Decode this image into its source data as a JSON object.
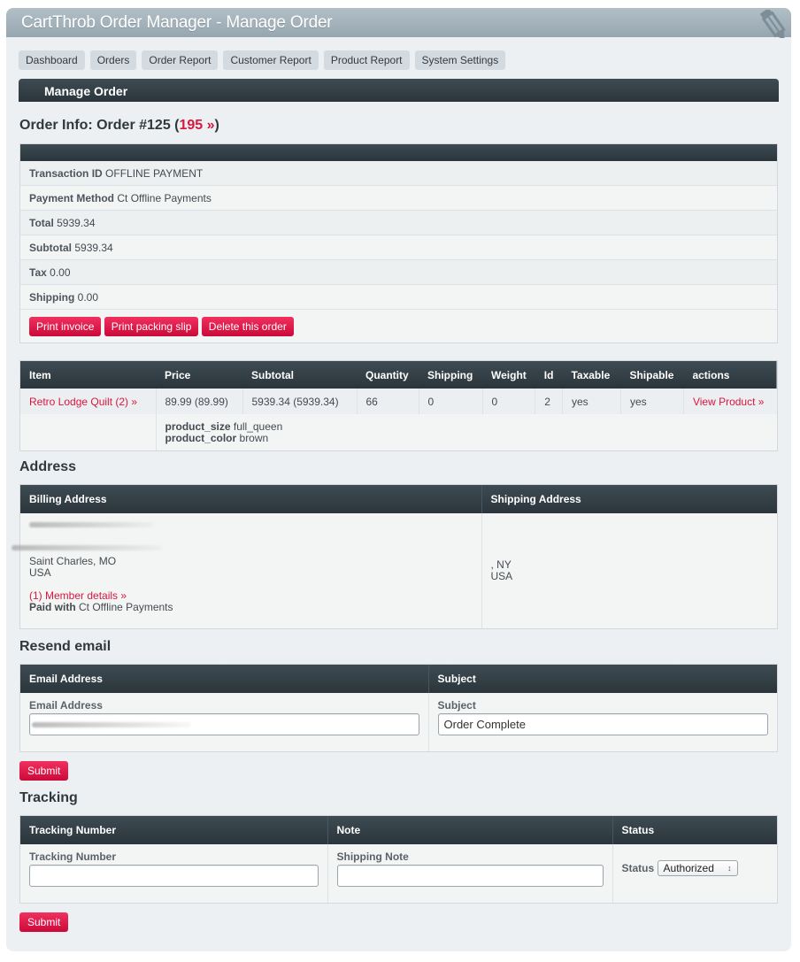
{
  "window": {
    "title": "CartThrob Order Manager - Manage Order",
    "corner_icon": "pencil-icon"
  },
  "nav": {
    "items": [
      {
        "label": "Dashboard"
      },
      {
        "label": "Orders"
      },
      {
        "label": "Order Report"
      },
      {
        "label": "Customer Report"
      },
      {
        "label": "Product Report"
      },
      {
        "label": "System Settings"
      }
    ]
  },
  "section_bar": {
    "title": "Manage Order"
  },
  "order_info": {
    "heading_prefix": "Order Info: Order #125 (",
    "heading_link": "195 »",
    "heading_suffix": ")",
    "rows": [
      {
        "label": "Transaction ID",
        "value": "OFFLINE PAYMENT"
      },
      {
        "label": "Payment Method",
        "value": "Ct Offline Payments"
      },
      {
        "label": "Total",
        "value": "5939.34"
      },
      {
        "label": "Subtotal",
        "value": "5939.34"
      },
      {
        "label": "Tax",
        "value": "0.00"
      },
      {
        "label": "Shipping",
        "value": "0.00"
      }
    ],
    "buttons": {
      "print_invoice": "Print invoice",
      "print_packing_slip": "Print packing slip",
      "delete_order": "Delete this order"
    }
  },
  "items_table": {
    "headers": [
      "Item",
      "Price",
      "Subtotal",
      "Quantity",
      "Shipping",
      "Weight",
      "Id",
      "Taxable",
      "Shipable",
      "actions"
    ],
    "rows": [
      {
        "item": "Retro Lodge Quilt (2) »",
        "price": "89.99 (89.99)",
        "subtotal": "5939.34 (5939.34)",
        "quantity": "66",
        "shipping": "0",
        "weight": "0",
        "id": "2",
        "taxable": "yes",
        "shipable": "yes",
        "action": "View Product »",
        "options": [
          {
            "label": "product_size",
            "value": "full_queen"
          },
          {
            "label": "product_color",
            "value": "brown"
          }
        ]
      }
    ]
  },
  "address": {
    "heading": "Address",
    "billing_header": "Billing Address",
    "shipping_header": "Shipping Address",
    "billing": {
      "city_state": "Saint Charles, MO",
      "country": "USA",
      "member_link": "(1) Member details »",
      "paid_with_label": "Paid with",
      "paid_with_value": "Ct Offline Payments"
    },
    "shipping": {
      "city_state": ", NY",
      "country": "USA"
    }
  },
  "resend_email": {
    "heading": "Resend email",
    "col1_header": "Email Address",
    "col2_header": "Subject",
    "email_label": "Email Address",
    "email_value": "",
    "subject_label": "Subject",
    "subject_value": "Order Complete",
    "submit_label": "Submit"
  },
  "tracking": {
    "heading": "Tracking",
    "col1_header": "Tracking Number",
    "col2_header": "Note",
    "col3_header": "Status",
    "tracking_label": "Tracking Number",
    "tracking_value": "",
    "note_label": "Shipping Note",
    "note_value": "",
    "status_label": "Status",
    "status_selected": "Authorized",
    "submit_label": "Submit"
  },
  "colors": {
    "accent_red": "#d8163f",
    "header_dark": "#2b353b",
    "background": "#ecf0f2"
  }
}
